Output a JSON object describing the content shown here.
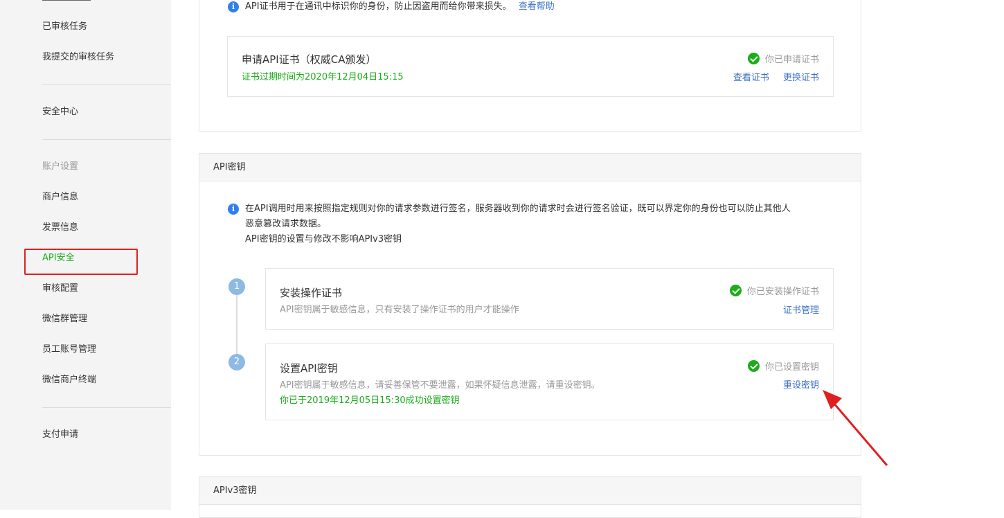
{
  "sidebar": {
    "items_top": [
      "已审核任务",
      "我提交的审核任务"
    ],
    "security_center": "安全中心",
    "group_label": "账户设置",
    "items": [
      "商户信息",
      "发票信息",
      "API安全",
      "审核配置",
      "微信群管理",
      "员工账号管理",
      "微信商户终端"
    ],
    "pay_apply": "支付申请"
  },
  "cert_section": {
    "info_text": "API证书用于在通讯中标识你的身份，防止因盗用而给你带来损失。",
    "help_link": "查看帮助",
    "card": {
      "title": "申请API证书（权威CA颁发）",
      "expiry": "证书过期时间为2020年12月04日15:15",
      "status": "你已申请证书",
      "link_view": "查看证书",
      "link_replace": "更换证书"
    }
  },
  "key_section": {
    "header": "API密钥",
    "info_line1": "在API调用时用来按照指定规则对你的请求参数进行签名，服务器收到你的请求时会进行签名验证，既可以界定你的身份也可以防止其他人",
    "info_line2": "恶意篡改请求数据。",
    "info_line3": "API密钥的设置与修改不影响APIv3密钥",
    "steps": [
      {
        "number": "1",
        "title": "安装操作证书",
        "desc": "API密钥属于敏感信息，只有安装了操作证书的用户才能操作",
        "status": "你已安装操作证书",
        "link": "证书管理"
      },
      {
        "number": "2",
        "title": "设置API密钥",
        "desc": "API密钥属于敏感信息，请妥善保管不要泄露，如果怀疑信息泄露，请重设密钥。",
        "note": "你已于2019年12月05日15:30成功设置密钥",
        "status": "你已设置密钥",
        "link": "重设密钥"
      }
    ]
  },
  "v3_section": {
    "header": "APIv3密钥"
  },
  "colors": {
    "accent_green": "#1aad19",
    "link_blue": "#3b6fc5",
    "info_blue": "#2f80ed",
    "annotation_red": "#e02020"
  },
  "icons": {
    "info": "info-icon",
    "check": "check-circle-icon",
    "arrow": "annotation-arrow"
  }
}
